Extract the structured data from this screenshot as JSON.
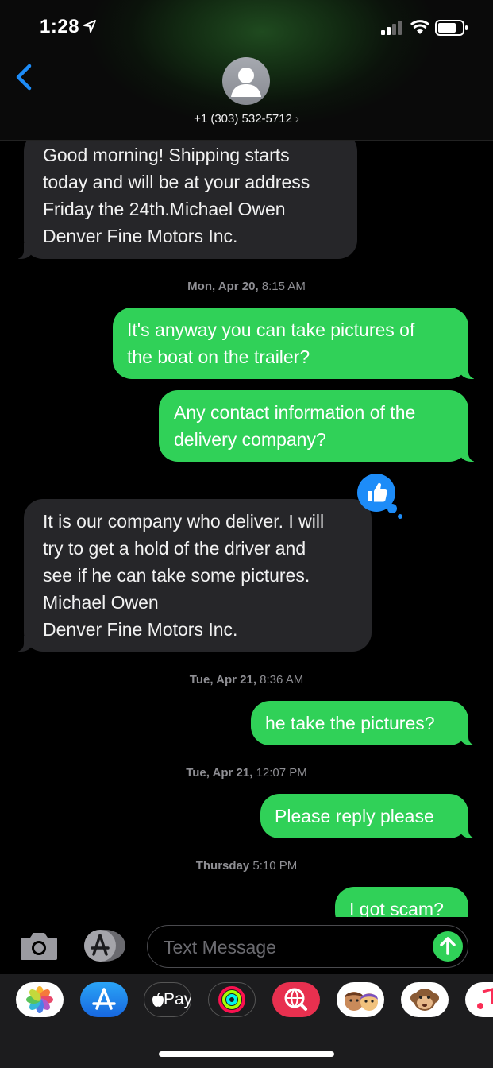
{
  "status": {
    "time": "1:28"
  },
  "contact": {
    "phone": "+1 (303) 532-5712",
    "chevron": "›"
  },
  "messages": [
    {
      "type": "received",
      "lines": [
        "Good morning! Shipping starts",
        "today and will be at your address",
        "Friday the 24th.Michael Owen",
        "Denver Fine Motors Inc."
      ]
    },
    {
      "type": "sent",
      "lines": [
        "It's anyway you can take pictures of",
        "the boat on the trailer?"
      ]
    },
    {
      "type": "sent",
      "lines": [
        "Any contact information of the",
        "delivery company?"
      ]
    },
    {
      "type": "received",
      "lines": [
        "It is our company who deliver. I will",
        "try to get a hold of the driver and",
        "see if he can take some pictures.",
        "Michael Owen",
        "Denver Fine Motors Inc."
      ],
      "reaction": "thumbs-up"
    },
    {
      "type": "sent",
      "lines": [
        "he take the pictures?"
      ]
    },
    {
      "type": "sent",
      "lines": [
        "Please reply please"
      ]
    },
    {
      "type": "sent",
      "lines": [
        "I got scam?"
      ]
    }
  ],
  "timestamps": [
    {
      "day": "Mon, Apr 20,",
      "time": "8:15 AM"
    },
    {
      "day": "Tue, Apr 21,",
      "time": "8:36 AM"
    },
    {
      "day": "Tue, Apr 21,",
      "time": "12:07 PM"
    },
    {
      "day": "Thursday",
      "time": "5:10 PM"
    }
  ],
  "input": {
    "placeholder": "Text Message",
    "value": ""
  },
  "app_tray": [
    "photos-icon",
    "app-store-icon",
    "apple-pay-icon",
    "activity-icon",
    "web-images-icon",
    "memoji-icon",
    "animoji-monkey-icon",
    "music-icon"
  ],
  "app_tray_labels": {
    "apple_pay": "Pay"
  },
  "colors": {
    "sent": "#30d158",
    "received": "#262629",
    "accent": "#1d8cf8"
  }
}
